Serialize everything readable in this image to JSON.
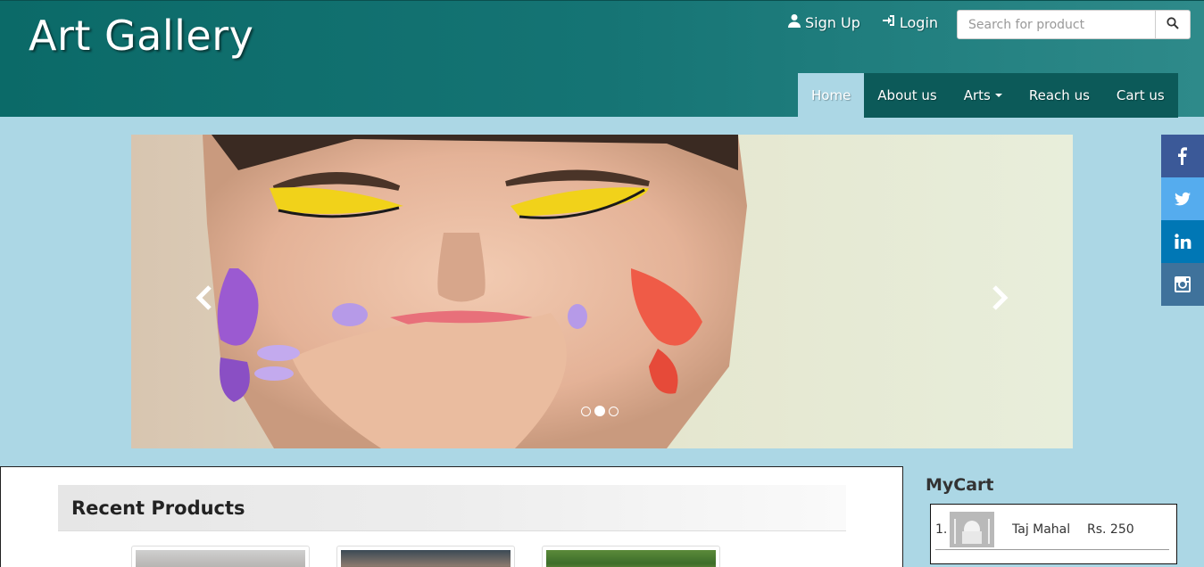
{
  "header": {
    "brand": "Art Gallery",
    "signup_label": "Sign Up",
    "login_label": "Login",
    "search": {
      "placeholder": "Search for product",
      "value": ""
    }
  },
  "nav": {
    "items": [
      {
        "label": "Home",
        "active": true
      },
      {
        "label": "About us",
        "active": false
      },
      {
        "label": "Arts",
        "active": false,
        "dropdown": true
      },
      {
        "label": "Reach us",
        "active": false
      },
      {
        "label": "Cart us",
        "active": false
      }
    ]
  },
  "carousel": {
    "slide_count": 3,
    "active_index": 1
  },
  "social": {
    "items": [
      {
        "icon": "facebook-icon",
        "color": "#3b5998"
      },
      {
        "icon": "twitter-icon",
        "color": "#55acee"
      },
      {
        "icon": "linkedin-icon",
        "color": "#0077b5"
      },
      {
        "icon": "instagram-icon",
        "color": "#3f729b"
      }
    ]
  },
  "main": {
    "recent_title": "Recent Products"
  },
  "cart": {
    "title": "MyCart",
    "items": [
      {
        "index": "1.",
        "name": "Taj Mahal",
        "price": "Rs. 250"
      }
    ]
  },
  "colors": {
    "header": "#0b6a68",
    "page_bg": "#acd7e5",
    "nav_bg": "#0c5a59"
  }
}
